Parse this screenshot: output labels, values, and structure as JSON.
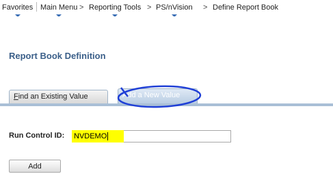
{
  "nav": {
    "favorites": "Favorites",
    "main_menu": "Main Menu",
    "sep1": ">",
    "reporting_tools": "Reporting Tools",
    "sep2": ">",
    "psnvision": "PS/nVision",
    "sep3": ">",
    "define_report_book": "Define Report Book"
  },
  "page": {
    "title": "Report Book Definition"
  },
  "tabs": [
    {
      "access_key": "F",
      "label_rest": "ind an Existing Value"
    },
    {
      "label": "Add a New Value"
    }
  ],
  "form": {
    "run_control_label": "Run Control ID:",
    "run_control_value": "NVDEMO"
  },
  "buttons": {
    "add": "Add"
  },
  "colors": {
    "title": "#3b5f89",
    "highlight": "#ffff00",
    "annotation_circle": "#1f3fd6",
    "tab_strip": "#a9bfd6"
  }
}
